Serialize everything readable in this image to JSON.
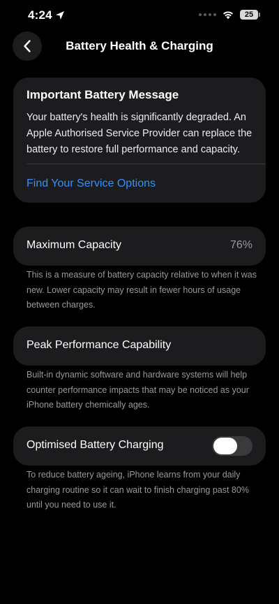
{
  "status_bar": {
    "time": "4:24",
    "battery_level": "25"
  },
  "nav": {
    "title": "Battery Health & Charging"
  },
  "battery_message": {
    "title": "Important Battery Message",
    "body": "Your battery's health is significantly degraded. An Apple Authorised Service Provider can replace the battery to restore full performance and capacity.",
    "link": "Find Your Service Options"
  },
  "maximum_capacity": {
    "label": "Maximum Capacity",
    "value": "76%",
    "footnote": "This is a measure of battery capacity relative to when it was new. Lower capacity may result in fewer hours of usage between charges."
  },
  "peak_performance": {
    "label": "Peak Performance Capability",
    "footnote": "Built-in dynamic software and hardware systems will help counter performance impacts that may be noticed as your iPhone battery chemically ages."
  },
  "optimised_charging": {
    "label": "Optimised Battery Charging",
    "enabled": false,
    "footnote": "To reduce battery ageing, iPhone learns from your daily charging routine so it can wait to finish charging past 80% until you need to use it."
  },
  "colors": {
    "background": "#000000",
    "card": "#1c1c1e",
    "link": "#3a8ff7",
    "secondary_text": "#98989e",
    "toggle_off": "#3a3a3c"
  },
  "icons": [
    "location-arrow-icon",
    "signal-dots-icon",
    "wifi-icon",
    "battery-icon",
    "chevron-left-icon"
  ]
}
